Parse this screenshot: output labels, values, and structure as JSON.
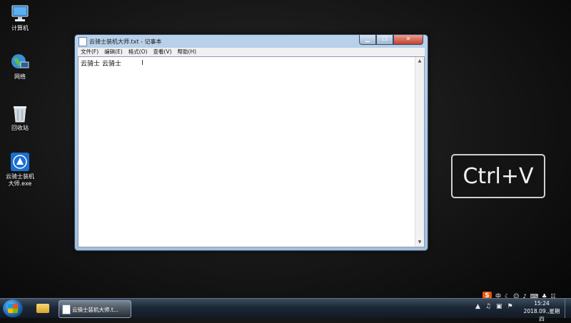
{
  "desktop": {
    "icons": [
      {
        "label": "计算机"
      },
      {
        "label": "网络"
      },
      {
        "label": "回收站"
      },
      {
        "label_line1": "云骑士装机",
        "label_line2": "大师.exe"
      }
    ]
  },
  "window": {
    "title": "云骑士装机大师.txt - 记事本",
    "menu": [
      "文件(F)",
      "编辑(E)",
      "格式(O)",
      "查看(V)",
      "帮助(H)"
    ],
    "content": "云骑士 云骑士"
  },
  "overlay": {
    "keys": "Ctrl+V"
  },
  "taskbar": {
    "task_label": "云骑士装机大师.t...",
    "ime": {
      "logo": "S",
      "mode": "中"
    },
    "clock_time": "15:24",
    "clock_date": "2018.09.,星期四"
  },
  "colors": {
    "ime_brand": "#e8540c",
    "titlebar": "#b9d1ea",
    "close_button": "#c33f2a"
  }
}
